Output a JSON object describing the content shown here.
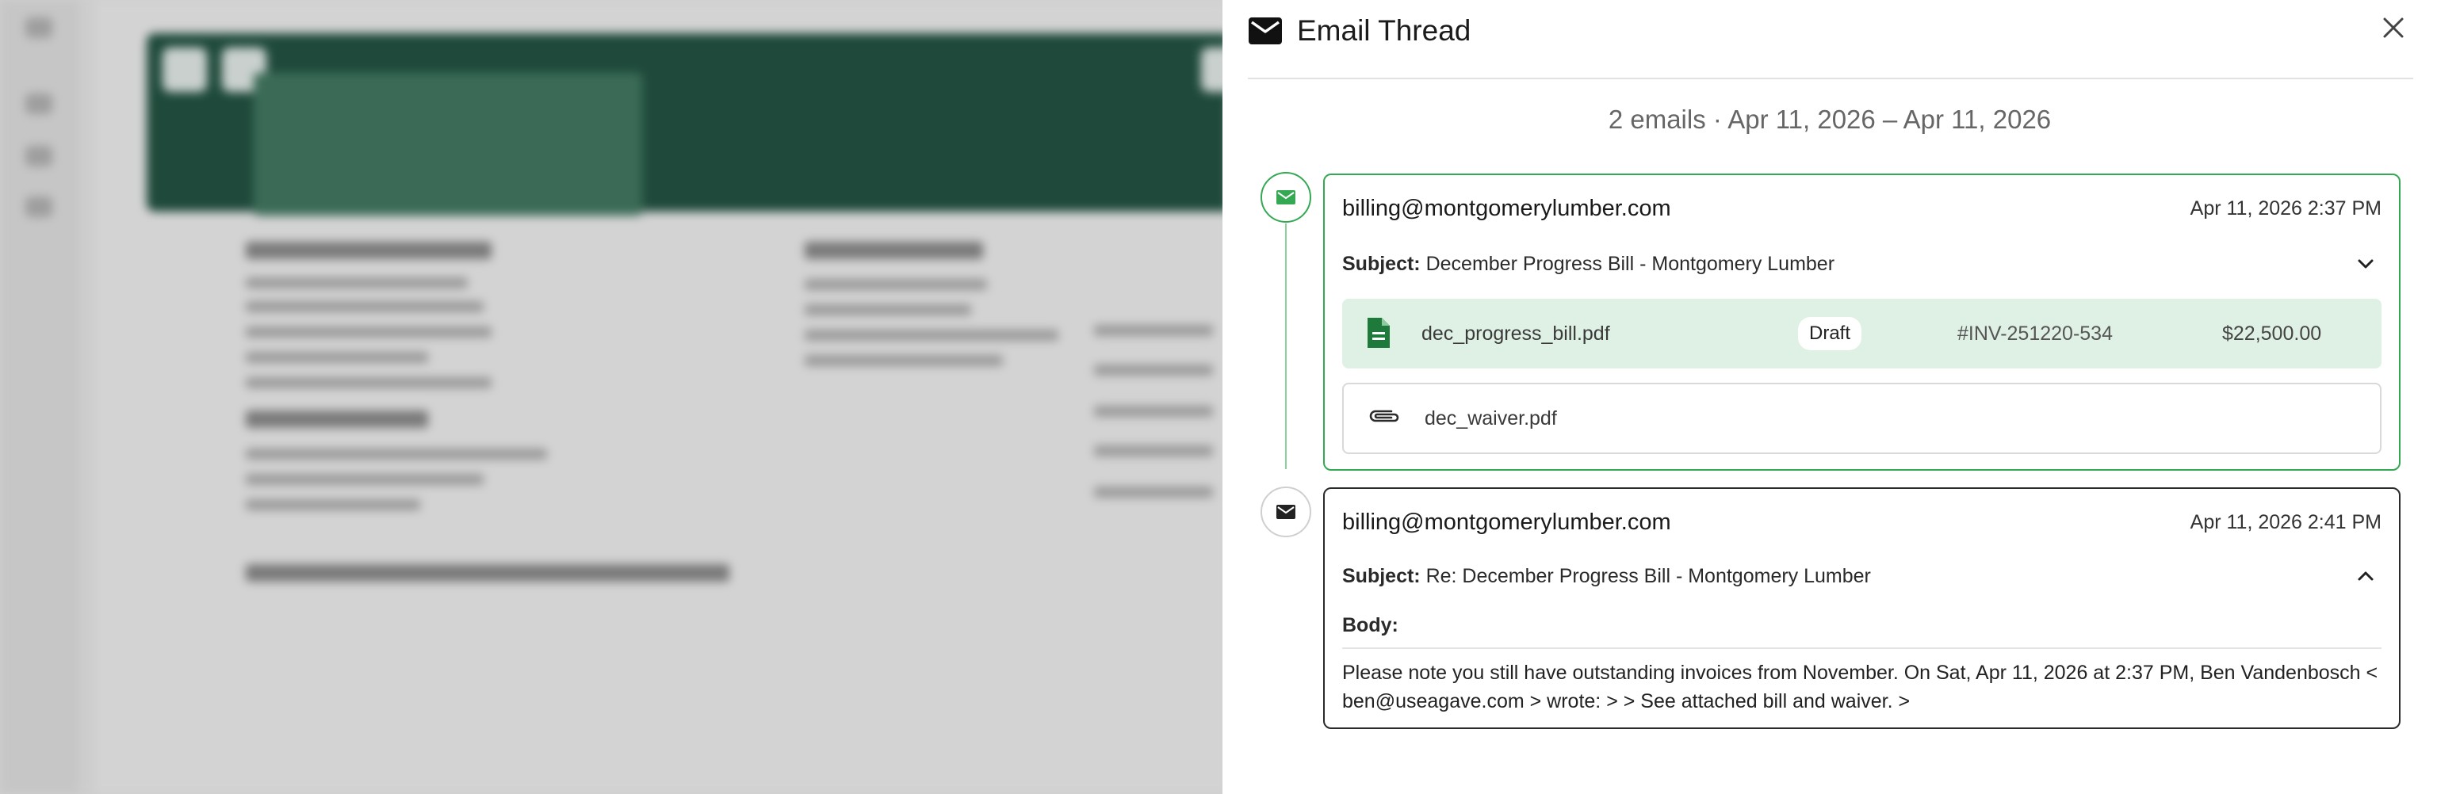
{
  "panel": {
    "title": "Email Thread",
    "summary": "2 emails · Apr 11, 2026 – Apr 11, 2026"
  },
  "emails": [
    {
      "sender": "billing@montgomerylumber.com",
      "timestamp": "Apr 11, 2026 2:37 PM",
      "subject_label": "Subject:",
      "subject": "December Progress Bill - Montgomery Lumber",
      "expanded": false,
      "attachments": [
        {
          "filename": "dec_progress_bill.pdf",
          "status": "Draft",
          "invoice_number": "#INV-251220-534",
          "amount": "$22,500.00",
          "icon": "file-icon"
        },
        {
          "filename": "dec_waiver.pdf",
          "icon": "paperclip-icon"
        }
      ]
    },
    {
      "sender": "billing@montgomerylumber.com",
      "timestamp": "Apr 11, 2026 2:41 PM",
      "subject_label": "Subject:",
      "subject": "Re: December Progress Bill - Montgomery Lumber",
      "expanded": true,
      "body_label": "Body:",
      "body": "Please note you still have outstanding invoices from November. On Sat, Apr 11, 2026 at 2:37 PM, Ben Vandenbosch < ben@useagave.com > wrote: > > See attached bill and waiver. >"
    }
  ],
  "colors": {
    "accent_green": "#35a853",
    "attachment_bg": "#dff1e5",
    "file_icon_green": "#1e7a3a",
    "background_header": "#1f4a3b"
  }
}
